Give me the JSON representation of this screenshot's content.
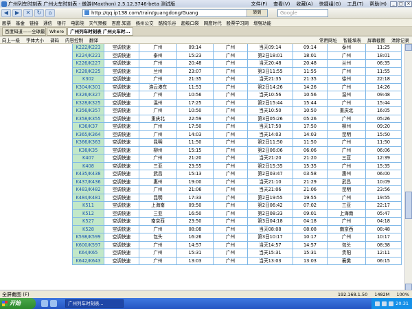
{
  "window": {
    "title": "广州列车时刻表 广州火车时刻表 - 傲游(Maxthon) 2.5.12.3746-beta 测试版",
    "menus": [
      "文件(F)",
      "查看(V)",
      "收藏(A)",
      "快捷组(G)",
      "工具(T)",
      "帮助(H)"
    ]
  },
  "address": {
    "url": "http://qq.ip138.com/train/guangdong/Guang",
    "go_label": "转到",
    "search_placeholder": "Google"
  },
  "favorites": [
    "股票",
    "基金",
    "链接",
    "通信",
    "银行",
    "电影院",
    "天气预报",
    "百度.知道",
    "扬州公交",
    "酷狗乐谷",
    "超级口袋",
    "网度时代",
    "股票学习网",
    "增强功能"
  ],
  "tabs": [
    "百度知道——全球最大中文...",
    "Where",
    "广州列车时刻表 广州火车时..."
  ],
  "subbar": {
    "items": [
      "向上一级",
      "字体大小",
      "调码",
      "内容控制",
      "翻译"
    ],
    "right": [
      "常用网址",
      "智能填表",
      "屏幕截图",
      "清除记录"
    ]
  },
  "table": {
    "rows": [
      [
        "K222/K223",
        "空调快速",
        "广州",
        "09:14",
        "广州",
        "当天09:14",
        "09:14",
        "泰州",
        "11:25"
      ],
      [
        "K224/K221",
        "空调快速",
        "泰州",
        "15:23",
        "广州",
        "第2日18:01",
        "18:01",
        "广州",
        "18:01"
      ],
      [
        "K226/K227",
        "空调快速",
        "广州",
        "20:48",
        "广州",
        "当天20:48",
        "20:48",
        "兰州",
        "06:35"
      ],
      [
        "K228/K225",
        "空调快速",
        "兰州",
        "23:07",
        "广州",
        "第3日11:55",
        "11:55",
        "广州",
        "11:55"
      ],
      [
        "K302",
        "空调快速",
        "广州",
        "21:35",
        "广州",
        "当天21:35",
        "21:35",
        "徐州",
        "22:18"
      ],
      [
        "K304/K301",
        "空调快速",
        "连云港东",
        "11:53",
        "广州",
        "第2日14:26",
        "14:26",
        "广州",
        "14:26"
      ],
      [
        "K326/K327",
        "空调快速",
        "广州",
        "10:56",
        "广州",
        "当天10:56",
        "10:56",
        "温州",
        "09:48"
      ],
      [
        "K328/K325",
        "空调快速",
        "温州",
        "17:25",
        "广州",
        "第2日15:44",
        "15:44",
        "广州",
        "15:44"
      ],
      [
        "K356/K357",
        "空调快速",
        "广州",
        "10:50",
        "广州",
        "当天10:50",
        "10:50",
        "重庆北",
        "16:05"
      ],
      [
        "K358/K355",
        "空调快速",
        "重庆北",
        "22:59",
        "广州",
        "第3日05:26",
        "05:26",
        "广州",
        "05:26"
      ],
      [
        "K36/K37",
        "空调快速",
        "广州",
        "17:50",
        "广州",
        "当天17:50",
        "17:50",
        "柳州",
        "09:20"
      ],
      [
        "K365/K364",
        "空调快速",
        "广州",
        "14:03",
        "广州",
        "当天14:03",
        "14:03",
        "昆明",
        "15:50"
      ],
      [
        "K366/K363",
        "空调快速",
        "昆明",
        "11:50",
        "广州",
        "第2日11:50",
        "11:50",
        "广州",
        "11:50"
      ],
      [
        "K38/K35",
        "空调快速",
        "柳州",
        "15:15",
        "广州",
        "第2日06:06",
        "06:06",
        "广州",
        "06:06"
      ],
      [
        "K407",
        "空调快速",
        "广州",
        "21:20",
        "广州",
        "当天21:20",
        "21:20",
        "三亚",
        "12:39"
      ],
      [
        "K408",
        "空调快速",
        "三亚",
        "23:55",
        "广州",
        "第2日15:35",
        "15:35",
        "广州",
        "15:35"
      ],
      [
        "K435/K438",
        "空调快速",
        "武昌",
        "15:13",
        "广州",
        "第2日03:47",
        "03:58",
        "惠州",
        "06:00"
      ],
      [
        "K437/K436",
        "空调快速",
        "惠州",
        "19:00",
        "广州",
        "当天21:10",
        "21:29",
        "武昌",
        "10:09"
      ],
      [
        "K483/K482",
        "空调快速",
        "广州",
        "21:06",
        "广州",
        "当天21:06",
        "21:06",
        "昆明",
        "23:56"
      ],
      [
        "K484/K481",
        "空调快速",
        "昆明",
        "17:33",
        "广州",
        "第2日19:55",
        "19:55",
        "广州",
        "19:55"
      ],
      [
        "K511",
        "空调快速",
        "上海南",
        "09:50",
        "广州",
        "第2日06:42",
        "07:02",
        "三亚",
        "22:17"
      ],
      [
        "K512",
        "空调快速",
        "三亚",
        "16:50",
        "广州",
        "第2日08:33",
        "09:01",
        "上海南",
        "05:47"
      ],
      [
        "K527",
        "空调快速",
        "南京西",
        "23:50",
        "广州",
        "第3日04:18",
        "04:18",
        "广州",
        "04:18"
      ],
      [
        "K528",
        "空调快速",
        "广州",
        "08:08",
        "广州",
        "当天08:08",
        "08:08",
        "南京西",
        "08:48"
      ],
      [
        "K598/K599",
        "空调快速",
        "包头",
        "16:26",
        "广州",
        "第3日10:17",
        "10:17",
        "广州",
        "10:17"
      ],
      [
        "K600/K597",
        "空调快速",
        "广州",
        "14:57",
        "广州",
        "当天14:57",
        "14:57",
        "包头",
        "08:38"
      ],
      [
        "K64/K65",
        "空调快速",
        "广州",
        "15:31",
        "广州",
        "当天15:31",
        "15:31",
        "贵阳",
        "12:11"
      ],
      [
        "K642/K643",
        "空调快速",
        "广州",
        "13:03",
        "广州",
        "当天13:03",
        "13:03",
        "襄樊",
        "06:15"
      ]
    ]
  },
  "statusbar": {
    "left": "全屏截图 (F)",
    "ip": "192.168.1.50",
    "mem": "1482M",
    "zoom": "100%"
  },
  "taskbar": {
    "start_label": "开始",
    "window_label": "广州列车时刻表...",
    "clock": "20:31"
  }
}
